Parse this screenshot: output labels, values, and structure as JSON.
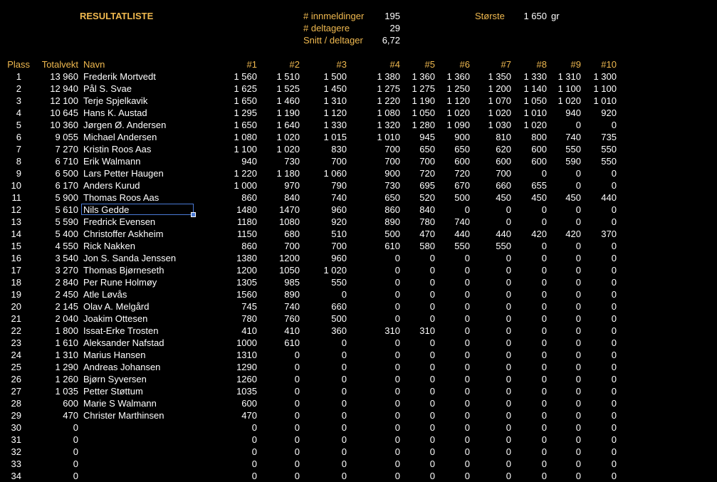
{
  "title": "RESULTATLISTE",
  "stats": {
    "entries_label": "# innmeldinger",
    "entries_value": "195",
    "participants_label": "# deltagere",
    "participants_value": "29",
    "average_label": "Snitt / deltager",
    "average_value": "6,72",
    "largest_label": "Største",
    "largest_value": "1 650",
    "largest_unit": "gr"
  },
  "headers": {
    "place": "Plass",
    "total": "Totalvekt",
    "name": "Navn",
    "fish": [
      "#1",
      "#2",
      "#3",
      "#4",
      "#5",
      "#6",
      "#7",
      "#8",
      "#9",
      "#10"
    ]
  },
  "selected_row": 11,
  "rows": [
    {
      "place": "1",
      "total": "13 960",
      "name": "Frederik Mortvedt",
      "fish": [
        "1 560",
        "1 510",
        "1 500",
        "1 380",
        "1 360",
        "1 360",
        "1 350",
        "1 330",
        "1 310",
        "1 300"
      ]
    },
    {
      "place": "2",
      "total": "12 940",
      "name": "Pål S. Svae",
      "fish": [
        "1 625",
        "1 525",
        "1 450",
        "1 275",
        "1 275",
        "1 250",
        "1 200",
        "1 140",
        "1 100",
        "1 100"
      ]
    },
    {
      "place": "3",
      "total": "12 100",
      "name": "Terje Spjelkavik",
      "fish": [
        "1 650",
        "1 460",
        "1 310",
        "1 220",
        "1 190",
        "1 120",
        "1 070",
        "1 050",
        "1 020",
        "1 010"
      ]
    },
    {
      "place": "4",
      "total": "10 645",
      "name": "Hans K. Austad",
      "fish": [
        "1 295",
        "1 190",
        "1 120",
        "1 080",
        "1 050",
        "1 020",
        "1 020",
        "1 010",
        "940",
        "920"
      ]
    },
    {
      "place": "5",
      "total": "10 360",
      "name": "Jørgen Ø. Andersen",
      "fish": [
        "1 650",
        "1 640",
        "1 330",
        "1 320",
        "1 280",
        "1 090",
        "1 030",
        "1 020",
        "0",
        "0"
      ]
    },
    {
      "place": "6",
      "total": "9 055",
      "name": "Michael Andersen",
      "fish": [
        "1 080",
        "1 020",
        "1 015",
        "1 010",
        "945",
        "900",
        "810",
        "800",
        "740",
        "735"
      ]
    },
    {
      "place": "7",
      "total": "7 270",
      "name": "Kristin Roos Aas",
      "fish": [
        "1 100",
        "1 020",
        "830",
        "700",
        "650",
        "650",
        "620",
        "600",
        "550",
        "550"
      ]
    },
    {
      "place": "8",
      "total": "6 710",
      "name": "Erik Walmann",
      "fish": [
        "940",
        "730",
        "700",
        "700",
        "700",
        "600",
        "600",
        "600",
        "590",
        "550"
      ]
    },
    {
      "place": "9",
      "total": "6 500",
      "name": "Lars Petter Haugen",
      "fish": [
        "1 220",
        "1 180",
        "1 060",
        "900",
        "720",
        "720",
        "700",
        "0",
        "0",
        "0"
      ]
    },
    {
      "place": "10",
      "total": "6 170",
      "name": "Anders Kurud",
      "fish": [
        "1 000",
        "970",
        "790",
        "730",
        "695",
        "670",
        "660",
        "655",
        "0",
        "0"
      ]
    },
    {
      "place": "11",
      "total": "5 900",
      "name": "Thomas Roos Aas",
      "fish": [
        "860",
        "840",
        "740",
        "650",
        "520",
        "500",
        "450",
        "450",
        "450",
        "440"
      ]
    },
    {
      "place": "12",
      "total": "5 610",
      "name": "Nils Gedde",
      "fish": [
        "1480",
        "1470",
        "960",
        "860",
        "840",
        "0",
        "0",
        "0",
        "0",
        "0"
      ]
    },
    {
      "place": "13",
      "total": "5 590",
      "name": "Fredrick Evensen",
      "fish": [
        "1180",
        "1080",
        "920",
        "890",
        "780",
        "740",
        "0",
        "0",
        "0",
        "0"
      ]
    },
    {
      "place": "14",
      "total": "5 400",
      "name": "Christoffer Askheim",
      "fish": [
        "1150",
        "680",
        "510",
        "500",
        "470",
        "440",
        "440",
        "420",
        "420",
        "370"
      ]
    },
    {
      "place": "15",
      "total": "4 550",
      "name": "Rick Nakken",
      "fish": [
        "860",
        "700",
        "700",
        "610",
        "580",
        "550",
        "550",
        "0",
        "0",
        "0"
      ]
    },
    {
      "place": "16",
      "total": "3 540",
      "name": "Jon S. Sanda Jenssen",
      "fish": [
        "1380",
        "1200",
        "960",
        "0",
        "0",
        "0",
        "0",
        "0",
        "0",
        "0"
      ]
    },
    {
      "place": "17",
      "total": "3 270",
      "name": "Thomas Bjørneseth",
      "fish": [
        "1200",
        "1050",
        "1 020",
        "0",
        "0",
        "0",
        "0",
        "0",
        "0",
        "0"
      ]
    },
    {
      "place": "18",
      "total": "2 840",
      "name": "Per Rune Holmøy",
      "fish": [
        "1305",
        "985",
        "550",
        "0",
        "0",
        "0",
        "0",
        "0",
        "0",
        "0"
      ]
    },
    {
      "place": "19",
      "total": "2 450",
      "name": "Atle Løvås",
      "fish": [
        "1560",
        "890",
        "0",
        "0",
        "0",
        "0",
        "0",
        "0",
        "0",
        "0"
      ]
    },
    {
      "place": "20",
      "total": "2 145",
      "name": "Olav A. Melgård",
      "fish": [
        "745",
        "740",
        "660",
        "0",
        "0",
        "0",
        "0",
        "0",
        "0",
        "0"
      ]
    },
    {
      "place": "21",
      "total": "2 040",
      "name": "Joakim Ottesen",
      "fish": [
        "780",
        "760",
        "500",
        "0",
        "0",
        "0",
        "0",
        "0",
        "0",
        "0"
      ]
    },
    {
      "place": "22",
      "total": "1 800",
      "name": "Issat-Erke Trosten",
      "fish": [
        "410",
        "410",
        "360",
        "310",
        "310",
        "0",
        "0",
        "0",
        "0",
        "0"
      ]
    },
    {
      "place": "23",
      "total": "1 610",
      "name": "Aleksander Nafstad",
      "fish": [
        "1000",
        "610",
        "0",
        "0",
        "0",
        "0",
        "0",
        "0",
        "0",
        "0"
      ]
    },
    {
      "place": "24",
      "total": "1 310",
      "name": "Marius Hansen",
      "fish": [
        "1310",
        "0",
        "0",
        "0",
        "0",
        "0",
        "0",
        "0",
        "0",
        "0"
      ]
    },
    {
      "place": "25",
      "total": "1 290",
      "name": "Andreas Johansen",
      "fish": [
        "1290",
        "0",
        "0",
        "0",
        "0",
        "0",
        "0",
        "0",
        "0",
        "0"
      ]
    },
    {
      "place": "26",
      "total": "1 260",
      "name": "Bjørn Syversen",
      "fish": [
        "1260",
        "0",
        "0",
        "0",
        "0",
        "0",
        "0",
        "0",
        "0",
        "0"
      ]
    },
    {
      "place": "27",
      "total": "1 035",
      "name": "Petter Støttum",
      "fish": [
        "1035",
        "0",
        "0",
        "0",
        "0",
        "0",
        "0",
        "0",
        "0",
        "0"
      ]
    },
    {
      "place": "28",
      "total": "600",
      "name": "Marie S Walmann",
      "fish": [
        "600",
        "0",
        "0",
        "0",
        "0",
        "0",
        "0",
        "0",
        "0",
        "0"
      ]
    },
    {
      "place": "29",
      "total": "470",
      "name": "Christer Marthinsen",
      "fish": [
        "470",
        "0",
        "0",
        "0",
        "0",
        "0",
        "0",
        "0",
        "0",
        "0"
      ]
    },
    {
      "place": "30",
      "total": "0",
      "name": "",
      "fish": [
        "0",
        "0",
        "0",
        "0",
        "0",
        "0",
        "0",
        "0",
        "0",
        "0"
      ]
    },
    {
      "place": "31",
      "total": "0",
      "name": "",
      "fish": [
        "0",
        "0",
        "0",
        "0",
        "0",
        "0",
        "0",
        "0",
        "0",
        "0"
      ]
    },
    {
      "place": "32",
      "total": "0",
      "name": "",
      "fish": [
        "0",
        "0",
        "0",
        "0",
        "0",
        "0",
        "0",
        "0",
        "0",
        "0"
      ]
    },
    {
      "place": "33",
      "total": "0",
      "name": "",
      "fish": [
        "0",
        "0",
        "0",
        "0",
        "0",
        "0",
        "0",
        "0",
        "0",
        "0"
      ]
    },
    {
      "place": "34",
      "total": "0",
      "name": "",
      "fish": [
        "0",
        "0",
        "0",
        "0",
        "0",
        "0",
        "0",
        "0",
        "0",
        "0"
      ]
    }
  ]
}
